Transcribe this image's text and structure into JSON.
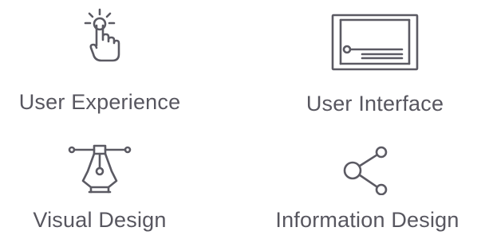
{
  "services": [
    {
      "label": "User Experience",
      "icon": "pointer-hand-icon"
    },
    {
      "label": "User Interface",
      "icon": "browser-window-icon"
    },
    {
      "label": "Visual Design",
      "icon": "pen-tool-icon"
    },
    {
      "label": "Information Design",
      "icon": "share-nodes-icon"
    }
  ],
  "colors": {
    "icon": "#5b5a63",
    "text": "#57565f",
    "background": "#ffffff"
  }
}
